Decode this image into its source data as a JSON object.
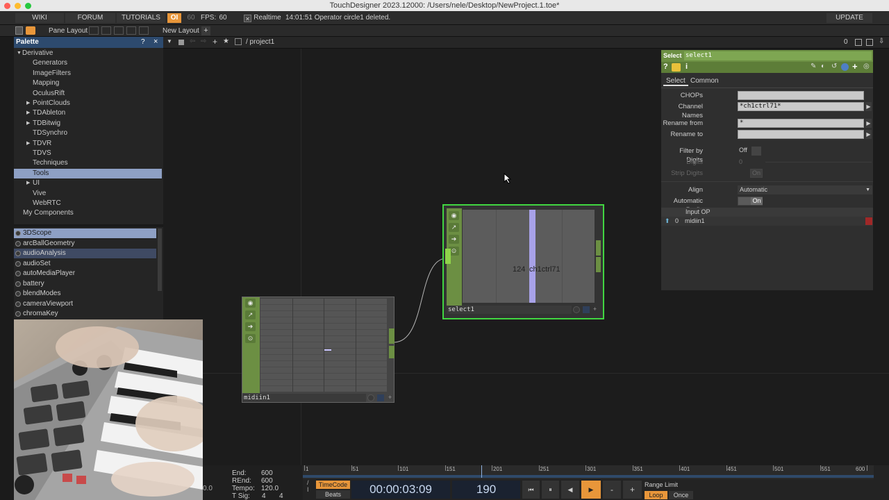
{
  "window": {
    "title": "TouchDesigner 2023.12000: /Users/nele/Desktop/NewProject.1.toe*"
  },
  "menubar": {
    "wiki": "WIKI",
    "forum": "FORUM",
    "tutorials": "TUTORIALS",
    "oi": "OI",
    "fps_target": "60",
    "fps_label": "FPS:",
    "fps_value": "60",
    "realtime_check": "✕",
    "realtime": "Realtime",
    "status_message": "14:01:51 Operator circle1 deleted.",
    "update": "UPDATE"
  },
  "panebar": {
    "pane_layout": "Pane Layout",
    "new_layout": "New Layout",
    "add": "+"
  },
  "palette": {
    "title": "Palette",
    "help": "?",
    "close": "×",
    "tree": [
      {
        "label": "Derivative",
        "indent": 0,
        "arrow": "▼"
      },
      {
        "label": "Generators",
        "indent": 2,
        "arrow": ""
      },
      {
        "label": "ImageFilters",
        "indent": 2,
        "arrow": ""
      },
      {
        "label": "Mapping",
        "indent": 2,
        "arrow": ""
      },
      {
        "label": "OculusRift",
        "indent": 2,
        "arrow": ""
      },
      {
        "label": "PointClouds",
        "indent": 2,
        "arrow": "▶"
      },
      {
        "label": "TDAbleton",
        "indent": 2,
        "arrow": "▶"
      },
      {
        "label": "TDBitwig",
        "indent": 2,
        "arrow": "▶"
      },
      {
        "label": "TDSynchro",
        "indent": 2,
        "arrow": ""
      },
      {
        "label": "TDVR",
        "indent": 2,
        "arrow": "▶"
      },
      {
        "label": "TDVS",
        "indent": 2,
        "arrow": ""
      },
      {
        "label": "Techniques",
        "indent": 2,
        "arrow": ""
      },
      {
        "label": "Tools",
        "indent": 2,
        "arrow": "",
        "selected": true
      },
      {
        "label": "UI",
        "indent": 2,
        "arrow": "▶"
      },
      {
        "label": "Vive",
        "indent": 2,
        "arrow": ""
      },
      {
        "label": "WebRTC",
        "indent": 2,
        "arrow": ""
      },
      {
        "label": "My Components",
        "indent": 1,
        "arrow": ""
      }
    ],
    "components": [
      {
        "label": "3DScope",
        "highlight": "light"
      },
      {
        "label": "arcBallGeometry",
        "highlight": ""
      },
      {
        "label": "audioAnalysis",
        "highlight": "dark"
      },
      {
        "label": "audioSet",
        "highlight": ""
      },
      {
        "label": "autoMediaPlayer",
        "highlight": ""
      },
      {
        "label": "battery",
        "highlight": ""
      },
      {
        "label": "blendModes",
        "highlight": ""
      },
      {
        "label": "cameraViewport",
        "highlight": ""
      },
      {
        "label": "chromaKey",
        "highlight": ""
      }
    ]
  },
  "network": {
    "path": "/ project1",
    "counter": "0",
    "midi_node": {
      "name": "midiin1"
    },
    "select_node": {
      "name": "select1",
      "channel_value": "124",
      "channel_name": "ch1ctrl71"
    }
  },
  "params": {
    "op_type": "Select",
    "op_name": "select1",
    "tabs": [
      "Select",
      "Common"
    ],
    "chops_label": "CHOPs",
    "chops_value": "",
    "channel_names_label": "Channel Names",
    "channel_names_value": "*ch1ctrl71*",
    "rename_from_label": "Rename from",
    "rename_from_value": "*",
    "rename_to_label": "Rename to",
    "rename_to_value": "",
    "filter_digits_label": "Filter by Digits",
    "filter_digits_value": "Off",
    "digits_label": "Digits",
    "digits_value": "0",
    "strip_digits_label": "Strip Digits",
    "strip_digits_value": "On",
    "align_label": "Align",
    "align_value": "Automatic",
    "auto_prefix_label": "Automatic Prefix",
    "auto_prefix_value": "On",
    "input_op_header": "Input OP",
    "input_index": "0",
    "input_name": "midiin1"
  },
  "timeline": {
    "end_label": "End:",
    "end_value": "600",
    "rend_label": "REnd:",
    "rend_value": "600",
    "tempo_label": "Tempo:",
    "tempo_value": "120.0",
    "tsig_label": "T Sig:",
    "tsig_a": "4",
    "tsig_b": "4",
    "left_value": "0.0",
    "ruler_ticks": [
      "1",
      "51",
      "101",
      "151",
      "201",
      "251",
      "301",
      "351",
      "401",
      "451",
      "501",
      "551",
      "600"
    ],
    "timecode_btn": "TimeCode",
    "beats_btn": "Beats",
    "timecode": "00:00:03:09",
    "frame": "190",
    "range_limit": "Range Limit",
    "loop": "Loop",
    "once": "Once",
    "playhead_fraction": 0.315
  },
  "colors": {
    "op_green": "#6c8f43",
    "selected_border": "#41d641",
    "accent_orange": "#e8963a"
  }
}
